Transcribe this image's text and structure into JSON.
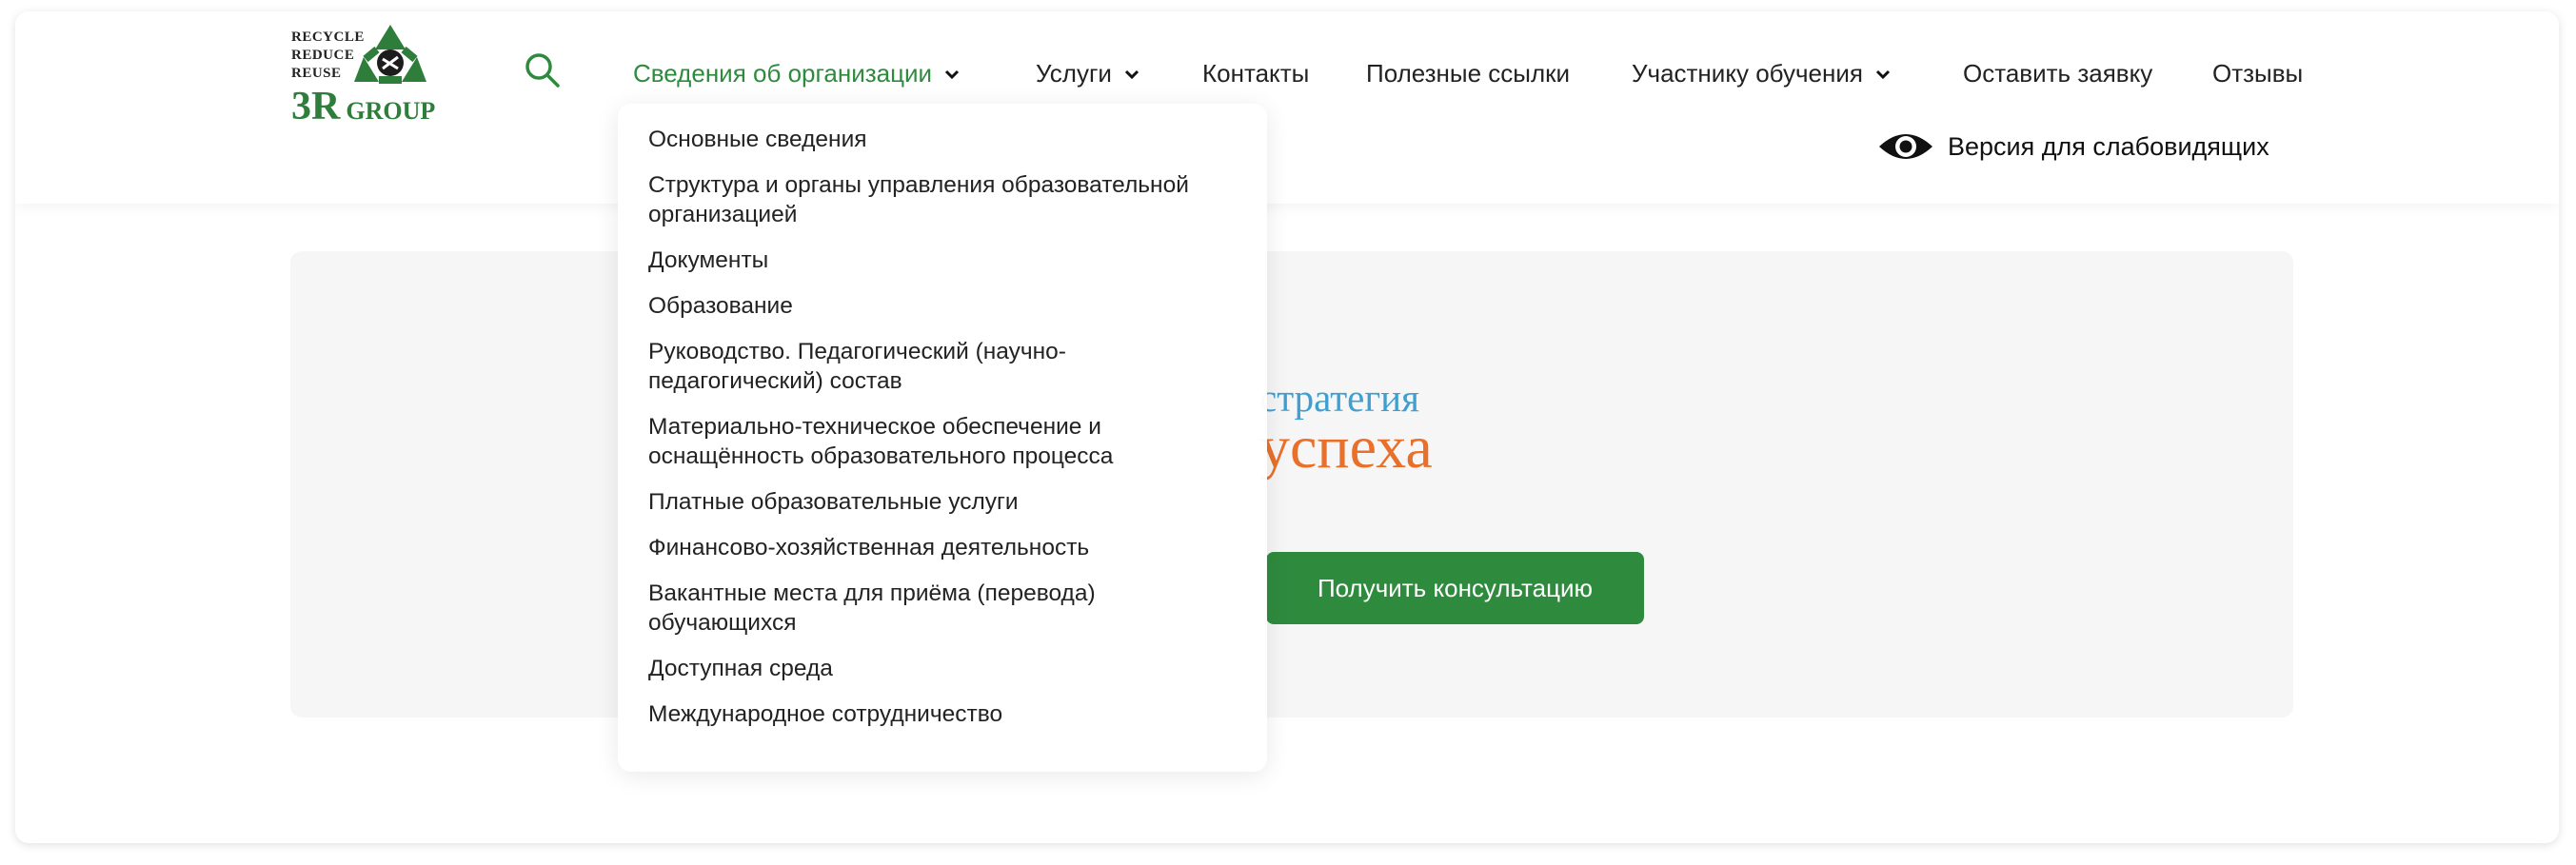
{
  "logo": {
    "line1": "RECYCLE",
    "line2": "REDUCE",
    "line3": "REUSE",
    "brand_big": "3R",
    "brand_small": "GROUP",
    "icon": "recycle-icon"
  },
  "search": {
    "icon": "search-icon"
  },
  "nav": {
    "items": [
      {
        "label": "Сведения об организации",
        "has_dropdown": true,
        "active": true
      },
      {
        "label": "Услуги",
        "has_dropdown": true
      },
      {
        "label": "Контакты"
      },
      {
        "label": "Полезные ссылки"
      },
      {
        "label": "Участнику обучения",
        "has_dropdown": true
      },
      {
        "label": "Оставить заявку"
      },
      {
        "label": "Отзывы"
      }
    ]
  },
  "vision": {
    "label": "Версия для слабовидящих",
    "icon": "eye-icon"
  },
  "dropdown": {
    "items": [
      "Основные сведения",
      "Структура и органы управления образовательной организацией",
      "Документы",
      "Образование",
      "Руководство. Педагогический (научно-педагогический) состав",
      "Материально-техническое обеспечение и оснащённость образовательного процесса",
      "Платные образовательные услуги",
      "Финансово-хозяйственная деятельность",
      "Вакантные места для приёма (перевода) обучающихся",
      "Доступная среда",
      "Международное сотрудничество"
    ]
  },
  "hero": {
    "brand_line1": "стратегия",
    "brand_line2": "успеха",
    "button_label": "Получить консультацию"
  },
  "colors": {
    "accent_green": "#2e8b3e",
    "brand_blue": "#3f9fd0",
    "brand_orange": "#e8702a",
    "hero_bg": "#f6f6f7"
  }
}
